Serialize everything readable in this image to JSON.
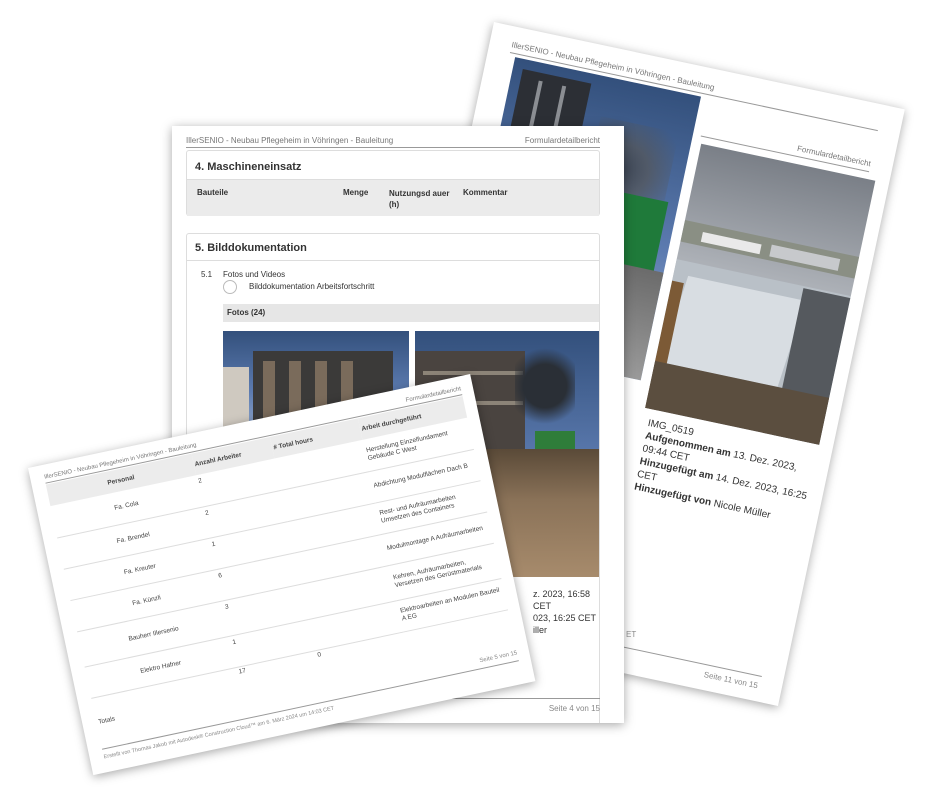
{
  "back_page": {
    "header_left": "IllerSENIO - Neubau Pflegeheim in Vöhringen - Bauleitung",
    "header_right": "Formulardetailbericht",
    "photo_label": "IMG_0519",
    "taken_label": "Aufgenommen am",
    "taken_value": "13. Dez. 2023, 09:44 CET",
    "added_label": "Hinzugefügt am",
    "added_value": "14. Dez. 2023, 16:25 CET",
    "by_label": "Hinzugefügt von",
    "by_value": "Nicole Müller",
    "footer": "Seite 11 von 15"
  },
  "middle_page": {
    "header_left": "IllerSENIO - Neubau Pflegeheim in Vöhringen - Bauleitung",
    "header_right": "Formulardetailbericht",
    "section4_title": "4. Maschineneinsatz",
    "col_bauteile": "Bauteile",
    "col_menge": "Menge",
    "col_nutzung": "Nutzungsd auer (h)",
    "col_kommentar": "Kommentar",
    "section5_title": "5. Bilddokumentation",
    "item_number": "5.1",
    "item_label": "Fotos und Videos",
    "item_option": "Bilddokumentation Arbeitsfortschritt",
    "fotos_bar": "Fotos (24)",
    "cap_line1": "z. 2023, 16:58 CET",
    "cap_line2": "023, 16:25 CET",
    "cap_line3": "iller",
    "footer": "Seite 4 von 15",
    "edge_text": "ET"
  },
  "front_page": {
    "header_left": "IllerSENIO - Neubau Pflegeheim in Vöhringen - Bauleitung",
    "header_right": "Formulardetailbericht",
    "columns": [
      "Personal",
      "Anzahl Arbeiter",
      "# Total hours",
      "Arbeit durchgeführt"
    ],
    "rows": [
      {
        "personal": "Fa. Cola",
        "arbeiter": "2",
        "hours": "",
        "arbeit": "Herstellung Einzelfundament Gebäude C West"
      },
      {
        "personal": "Fa. Brendel",
        "arbeiter": "2",
        "hours": "",
        "arbeit": "Abdichtung Modulflächen Dach B"
      },
      {
        "personal": "Fa. Kreuter",
        "arbeiter": "1",
        "hours": "",
        "arbeit": "Rest- und Aufräumarbeiten Umsetzen des Containers"
      },
      {
        "personal": "Fa. Künzli",
        "arbeiter": "6",
        "hours": "",
        "arbeit": "Modulmontage A Aufräumarbeiten"
      },
      {
        "personal": "Bauherr Illersenio",
        "arbeiter": "3",
        "hours": "",
        "arbeit": "Kehren, Aufräumarbeiten, Versetzen des Gerüstmaterials"
      },
      {
        "personal": "Elektro Hafner",
        "arbeiter": "1",
        "hours": "",
        "arbeit": "Elektroarbeiten an Modulen Bauteil A EG"
      }
    ],
    "totals_label": "Totals",
    "total_arbeiter": "17",
    "total_hours": "0",
    "footer_left": "Erstellt von Thomas Jakob mit Autodesk® Construction Cloud™ am 6. März 2024 um 14:03 CET",
    "footer_right": "Seite 5 von 15"
  }
}
